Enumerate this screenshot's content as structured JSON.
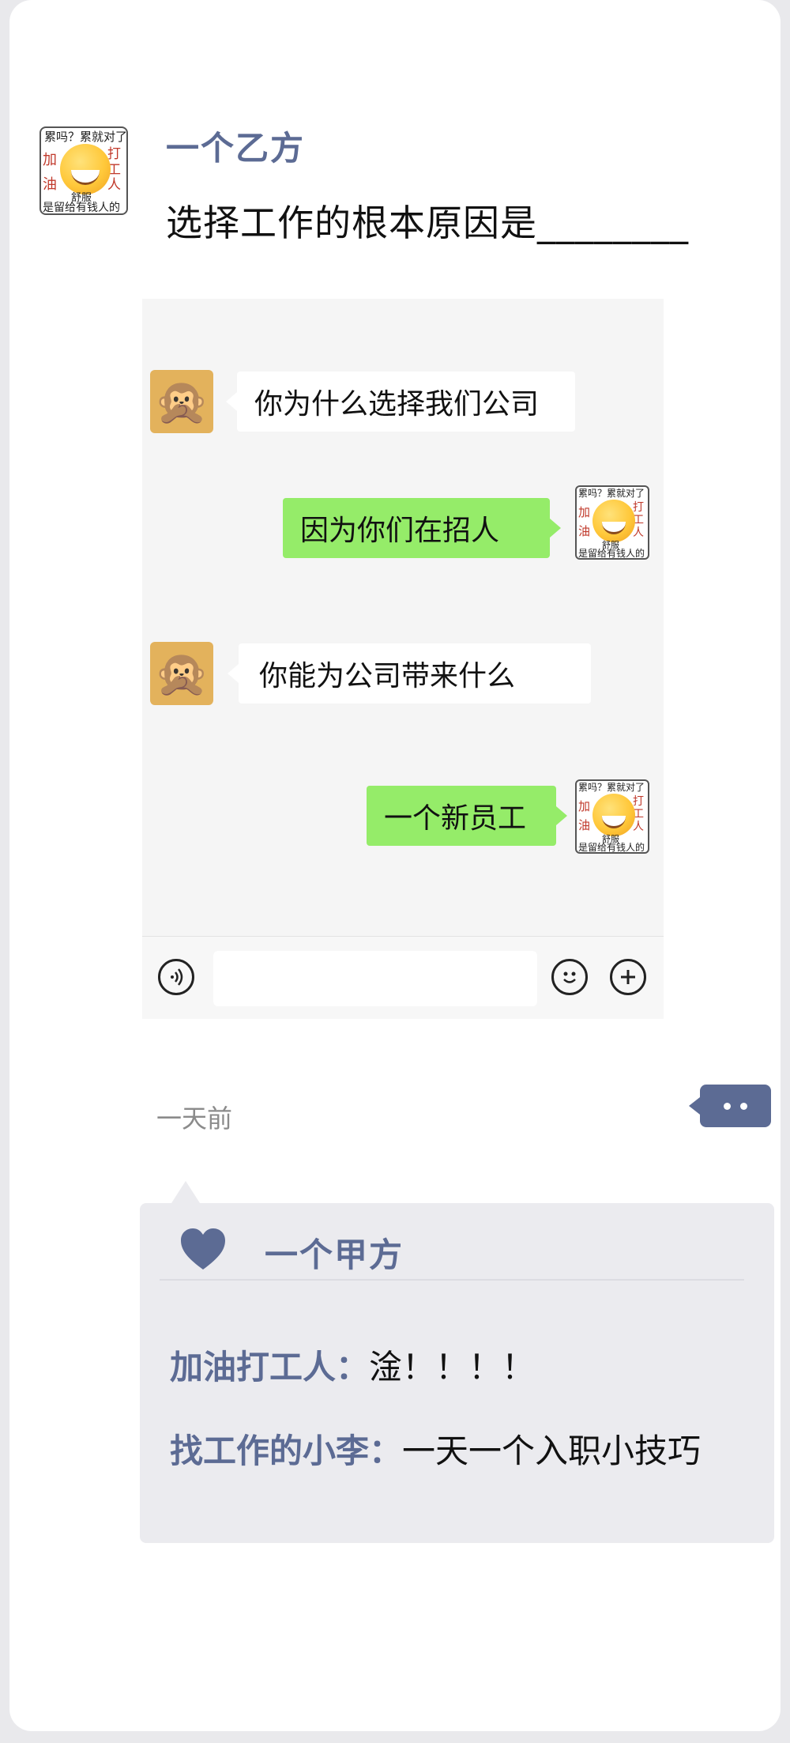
{
  "post": {
    "author": "一个乙方",
    "text": "选择工作的根本原因是________",
    "timestamp": "一天前"
  },
  "sticker": {
    "top_text": "累吗？累就对了",
    "left_text": "加油",
    "right_text": "打工人",
    "middle_text": "舒服",
    "bottom_text": "是留给有钱人的"
  },
  "chat": {
    "messages": [
      {
        "sender": "interviewer",
        "avatar": "🙊",
        "text": "你为什么选择我们公司"
      },
      {
        "sender": "me",
        "text": "因为你们在招人"
      },
      {
        "sender": "interviewer",
        "avatar": "🙊",
        "text": "你能为公司带来什么"
      },
      {
        "sender": "me",
        "text": "一个新员工"
      }
    ],
    "input_placeholder": ""
  },
  "likes": {
    "names": [
      "一个甲方"
    ]
  },
  "comments": [
    {
      "author": "加油打工人：",
      "text": "淦！！！！"
    },
    {
      "author": "找工作的小李：",
      "text": "一天一个入职小技巧"
    }
  ],
  "colors": {
    "accent": "#5c6b94",
    "green_bubble": "#95ec69",
    "background": "#e9e9ec"
  }
}
